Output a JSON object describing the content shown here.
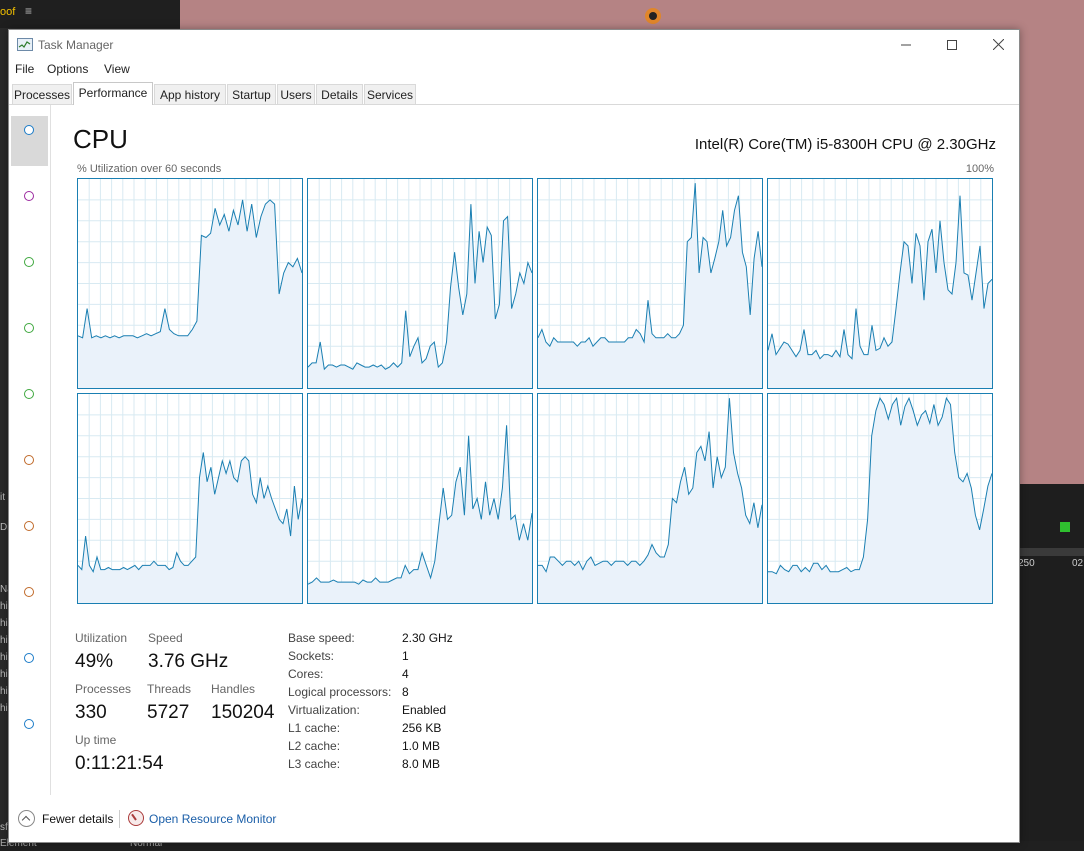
{
  "background": {
    "top_left_text": "oof",
    "top_left_menu": "≡",
    "left_lines": [
      "Na",
      "hi",
      "hi",
      "hi",
      "hi",
      "hi",
      "hi",
      "hi"
    ],
    "left_misc": [
      "it",
      "Di"
    ],
    "panel_numbers": [
      "250",
      "02"
    ],
    "bottom_left": "Element",
    "bottom_left2": "sf",
    "bottom_mid": "Normal"
  },
  "window": {
    "title": "Task Manager"
  },
  "menu": [
    "File",
    "Options",
    "View"
  ],
  "tabs": [
    {
      "label": "Processes",
      "active": false
    },
    {
      "label": "Performance",
      "active": true
    },
    {
      "label": "App history",
      "active": false
    },
    {
      "label": "Startup",
      "active": false
    },
    {
      "label": "Users",
      "active": false
    },
    {
      "label": "Details",
      "active": false
    },
    {
      "label": "Services",
      "active": false
    }
  ],
  "sidebar_colors": [
    "#1c7cc8",
    "#9c2aa0",
    "#3fa83f",
    "#3fa83f",
    "#3fa83f",
    "#c06a2a",
    "#c06a2a",
    "#c06a2a",
    "#1c7cc8",
    "#1c7cc8"
  ],
  "cpu": {
    "title": "CPU",
    "model": "Intel(R) Core(TM) i5-8300H CPU @ 2.30GHz",
    "graph_label": "% Utilization over 60 seconds",
    "graph_max": "100%"
  },
  "chart_data": {
    "type": "area",
    "y_range": [
      0,
      100
    ],
    "x_seconds": 60,
    "series": [
      {
        "values": [
          25,
          24,
          38,
          24,
          25,
          24,
          25,
          24,
          25,
          24,
          25,
          25,
          25,
          24,
          25,
          26,
          25,
          26,
          27,
          38,
          28,
          26,
          25,
          25,
          25,
          28,
          32,
          73,
          72,
          74,
          86,
          78,
          83,
          75,
          85,
          78,
          90,
          75,
          88,
          72,
          82,
          88,
          90,
          88,
          45,
          55,
          60,
          58,
          62,
          55
        ]
      },
      {
        "values": [
          10,
          12,
          12,
          22,
          9,
          11,
          11,
          10,
          11,
          11,
          10,
          9,
          12,
          11,
          10,
          10,
          11,
          10,
          11,
          9,
          10,
          12,
          10,
          12,
          37,
          15,
          20,
          24,
          12,
          14,
          20,
          22,
          10,
          12,
          22,
          48,
          65,
          48,
          35,
          45,
          88,
          50,
          75,
          60,
          77,
          73,
          33,
          40,
          80,
          82,
          38,
          45,
          55,
          50,
          60,
          55
        ]
      },
      {
        "values": [
          24,
          28,
          22,
          20,
          24,
          22,
          22,
          22,
          22,
          22,
          20,
          22,
          22,
          24,
          20,
          22,
          24,
          24,
          22,
          22,
          22,
          22,
          22,
          24,
          24,
          28,
          26,
          22,
          42,
          26,
          24,
          24,
          24,
          26,
          24,
          24,
          26,
          30,
          70,
          72,
          98,
          55,
          72,
          70,
          55,
          62,
          70,
          85,
          68,
          72,
          85,
          92,
          65,
          58,
          35,
          62,
          75,
          58
        ]
      },
      {
        "values": [
          18,
          26,
          16,
          19,
          22,
          21,
          18,
          15,
          18,
          28,
          16,
          16,
          18,
          14,
          16,
          16,
          15,
          18,
          15,
          28,
          16,
          14,
          38,
          20,
          16,
          16,
          30,
          18,
          19,
          24,
          20,
          22,
          38,
          55,
          70,
          68,
          50,
          74,
          68,
          42,
          70,
          76,
          55,
          80,
          60,
          47,
          45,
          60,
          92,
          55,
          54,
          42,
          55,
          68,
          38,
          50,
          52
        ]
      },
      {
        "values": [
          18,
          16,
          32,
          18,
          15,
          22,
          16,
          16,
          17,
          16,
          16,
          16,
          17,
          16,
          17,
          18,
          16,
          18,
          18,
          18,
          20,
          18,
          18,
          18,
          16,
          17,
          24,
          20,
          18,
          18,
          20,
          22,
          60,
          72,
          58,
          65,
          52,
          60,
          68,
          62,
          68,
          60,
          58,
          68,
          70,
          68,
          52,
          48,
          60,
          50,
          56,
          50,
          45,
          40,
          38,
          45,
          32,
          56,
          40,
          50
        ]
      },
      {
        "values": [
          9,
          10,
          12,
          10,
          10,
          10,
          11,
          10,
          10,
          10,
          10,
          10,
          9,
          11,
          10,
          10,
          12,
          10,
          10,
          10,
          11,
          12,
          12,
          18,
          14,
          16,
          16,
          24,
          18,
          12,
          20,
          38,
          55,
          40,
          42,
          58,
          65,
          42,
          80,
          45,
          50,
          40,
          58,
          42,
          50,
          40,
          55,
          85,
          40,
          42,
          30,
          38,
          30,
          43
        ]
      },
      {
        "values": [
          18,
          18,
          15,
          22,
          22,
          20,
          18,
          20,
          20,
          18,
          20,
          16,
          20,
          22,
          18,
          19,
          20,
          20,
          18,
          20,
          20,
          20,
          18,
          20,
          20,
          18,
          20,
          23,
          28,
          24,
          22,
          22,
          28,
          50,
          48,
          58,
          65,
          52,
          55,
          72,
          75,
          68,
          82,
          55,
          70,
          60,
          65,
          98,
          72,
          62,
          55,
          42,
          38,
          48,
          36,
          47
        ]
      },
      {
        "values": [
          15,
          15,
          14,
          18,
          16,
          15,
          18,
          18,
          15,
          17,
          15,
          19,
          19,
          16,
          18,
          15,
          15,
          15,
          16,
          17,
          15,
          16,
          16,
          22,
          40,
          80,
          92,
          98,
          95,
          88,
          95,
          98,
          85,
          94,
          98,
          92,
          85,
          90,
          92,
          86,
          95,
          85,
          89,
          98,
          95,
          72,
          60,
          58,
          62,
          55,
          42,
          35,
          45,
          56,
          62
        ]
      }
    ]
  },
  "stats": {
    "utilization_label": "Utilization",
    "utilization": "49%",
    "speed_label": "Speed",
    "speed": "3.76 GHz",
    "processes_label": "Processes",
    "processes": "330",
    "threads_label": "Threads",
    "threads": "5727",
    "handles_label": "Handles",
    "handles": "150204",
    "uptime_label": "Up time",
    "uptime": "0:11:21:54"
  },
  "specs": [
    {
      "label": "Base speed:",
      "value": "2.30 GHz"
    },
    {
      "label": "Sockets:",
      "value": "1"
    },
    {
      "label": "Cores:",
      "value": "4"
    },
    {
      "label": "Logical processors:",
      "value": "8"
    },
    {
      "label": "Virtualization:",
      "value": "Enabled"
    },
    {
      "label": "L1 cache:",
      "value": "256 KB"
    },
    {
      "label": "L2 cache:",
      "value": "1.0 MB"
    },
    {
      "label": "L3 cache:",
      "value": "8.0 MB"
    }
  ],
  "footer": {
    "fewer_details": "Fewer details",
    "open_resource_monitor": "Open Resource Monitor"
  },
  "colors": {
    "graph_line": "#1a7fb2",
    "graph_fill": "#eaf2fa",
    "grid": "#d8eaf2"
  }
}
